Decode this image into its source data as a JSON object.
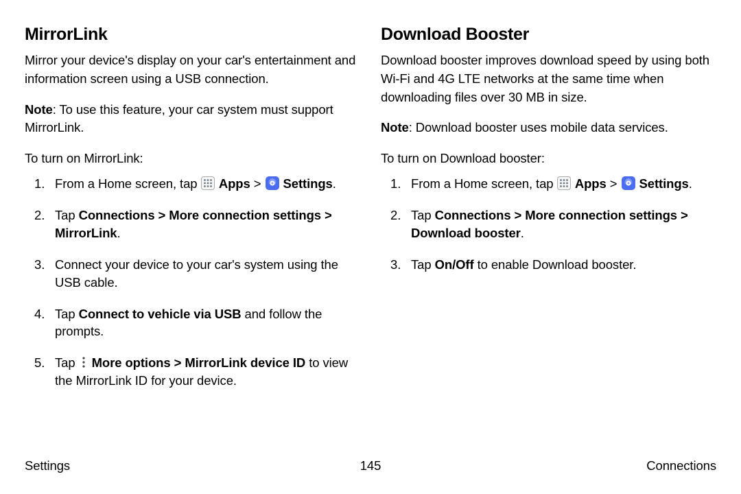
{
  "left": {
    "heading": "MirrorLink",
    "intro": "Mirror your device's display on your car's entertainment and information screen using a USB connection.",
    "note_label": "Note",
    "note_text": ": To use this feature, your car system must support MirrorLink.",
    "lead": "To turn on MirrorLink:",
    "s1_a": "From a Home screen, tap ",
    "s1_apps": " Apps",
    "s1_gt": " > ",
    "s1_settings": " Settings",
    "s1_dot": ".",
    "s2_a": "Tap ",
    "s2_b": "Connections > More connection settings > MirrorLink",
    "s2_c": ".",
    "s3": "Connect your device to your car's system using the USB cable.",
    "s4_a": "Tap ",
    "s4_b": "Connect to vehicle via USB",
    "s4_c": " and follow the prompts.",
    "s5_a": "Tap ",
    "s5_b": " More options > MirrorLink device ID",
    "s5_c": " to view the MirrorLink ID for your device."
  },
  "right": {
    "heading": "Download Booster",
    "intro": "Download booster improves download speed by using both Wi-Fi and 4G LTE networks at the same time when downloading files over 30 MB in size.",
    "note_label": "Note",
    "note_text": ": Download booster uses mobile data services.",
    "lead": "To turn on Download booster:",
    "s1_a": "From a Home screen, tap ",
    "s1_apps": " Apps",
    "s1_gt": " > ",
    "s1_settings": " Settings",
    "s1_dot": ".",
    "s2_a": "Tap ",
    "s2_b": "Connections > More connection settings > Download booster",
    "s2_c": ".",
    "s3_a": "Tap ",
    "s3_b": "On/Off",
    "s3_c": " to enable Download booster."
  },
  "footer": {
    "left": "Settings",
    "center": "145",
    "right": "Connections"
  }
}
